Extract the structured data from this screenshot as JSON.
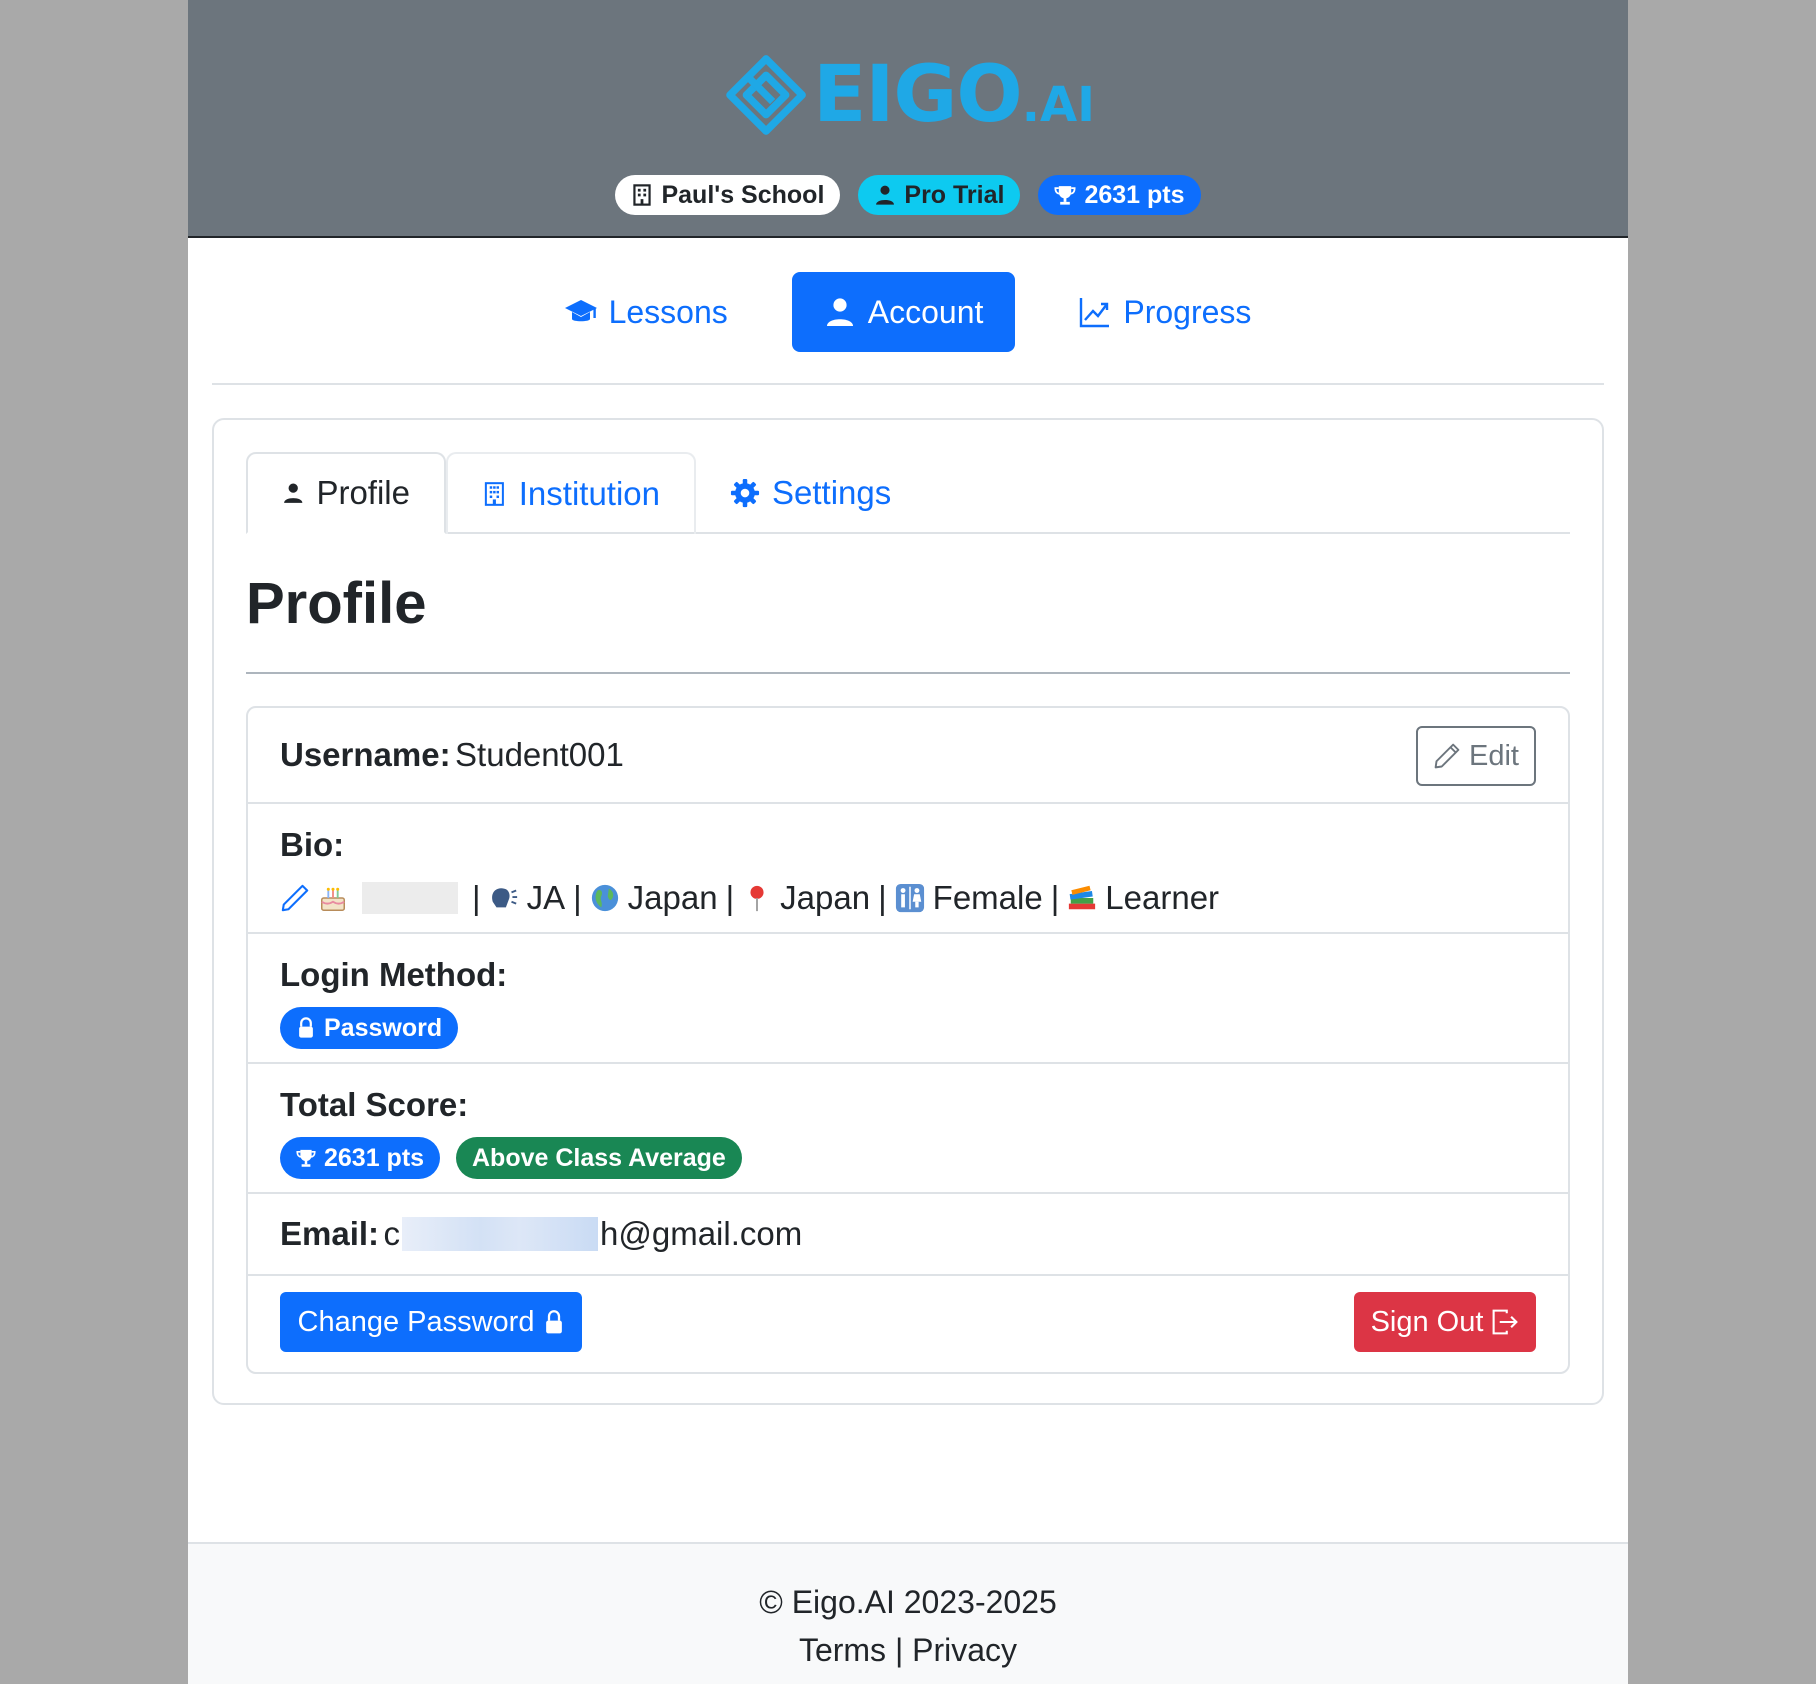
{
  "brand": {
    "name": "EIGO",
    "suffix": ".AI",
    "color": "#1fa8e6"
  },
  "header": {
    "school_badge": "Paul's School",
    "plan_badge": "Pro Trial",
    "points_badge": "2631 pts"
  },
  "nav": {
    "lessons": "Lessons",
    "account": "Account",
    "progress": "Progress"
  },
  "tabs": {
    "profile": "Profile",
    "institution": "Institution",
    "settings": "Settings"
  },
  "profile": {
    "heading": "Profile",
    "username_label": "Username:",
    "username_value": "Student001",
    "edit_label": "Edit",
    "bio_label": "Bio:",
    "bio": {
      "sep": "|",
      "language": "JA",
      "country": "Japan",
      "location": "Japan",
      "gender": "Female",
      "role": "Learner"
    },
    "login_label": "Login Method:",
    "login_method": "Password",
    "score_label": "Total Score:",
    "score_value": "2631 pts",
    "score_comparison": "Above Class Average",
    "email_label": "Email:",
    "email_start": "c",
    "email_end": "h@gmail.com",
    "change_password_label": "Change Password",
    "sign_out_label": "Sign Out"
  },
  "footer": {
    "copyright": "© Eigo.AI 2023-2025",
    "terms": "Terms",
    "separator": "|",
    "privacy": "Privacy"
  },
  "colors": {
    "primary": "#0d6efd",
    "info": "#0dcaf0",
    "success": "#198754",
    "danger": "#dc3545",
    "header_bg": "#6c757d"
  }
}
